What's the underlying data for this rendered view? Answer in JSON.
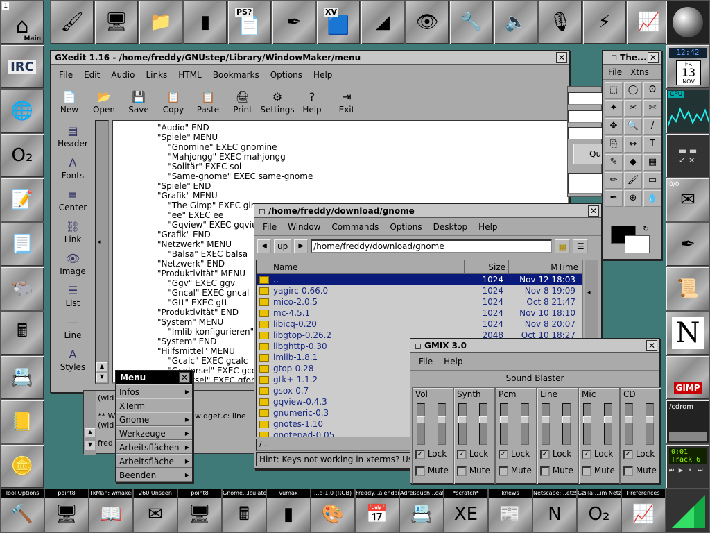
{
  "dock_top": [
    {
      "name": "main",
      "label": "Main",
      "glyph": "⌂",
      "badge": "1"
    },
    {
      "name": "paint",
      "glyph": "🖌"
    },
    {
      "name": "computer",
      "glyph": "🖥"
    },
    {
      "name": "folder",
      "glyph": "📁"
    },
    {
      "name": "drive",
      "glyph": "▮"
    },
    {
      "name": "ps-viewer",
      "label": "PS?",
      "glyph": "📄"
    },
    {
      "name": "acrobat",
      "glyph": "✒"
    },
    {
      "name": "xv",
      "label": "XV",
      "glyph": "🟦"
    },
    {
      "name": "xfig",
      "glyph": "◢"
    },
    {
      "name": "eye",
      "glyph": "👁"
    },
    {
      "name": "tools",
      "glyph": "🔧"
    },
    {
      "name": "speaker",
      "glyph": "🔈"
    },
    {
      "name": "microphone",
      "glyph": "🎙"
    },
    {
      "name": "network",
      "glyph": "⚡"
    },
    {
      "name": "monitor-graph",
      "glyph": "📈"
    }
  ],
  "dock_left": [
    {
      "name": "irc",
      "label": "IRC"
    },
    {
      "name": "earth-tools",
      "glyph": "🌐"
    },
    {
      "name": "o2",
      "glyph": "O₂"
    },
    {
      "name": "notepad",
      "glyph": "📝"
    },
    {
      "name": "document",
      "glyph": "📃"
    },
    {
      "name": "gnu",
      "glyph": "🐃"
    },
    {
      "name": "calculator",
      "glyph": "🖩"
    },
    {
      "name": "rolodex",
      "glyph": "📇"
    },
    {
      "name": "address",
      "glyph": "📒"
    },
    {
      "name": "coins",
      "glyph": "🪙"
    }
  ],
  "dock_right": {
    "clock_time": "12:42",
    "date_day": "FR",
    "date_num": "13",
    "date_month": "NOV",
    "cpu_label": "CPU",
    "mail_count": "0/0",
    "netscape": "N",
    "gimp": "GIMP",
    "cdrom_label": "/cdrom",
    "track_time": "0:01",
    "track_label": "Track",
    "track_num": "6"
  },
  "gxedit": {
    "title": "GXedit 1.16 - /home/freddy/GNUstep/Library/WindowMaker/menu",
    "menus": [
      "File",
      "Edit",
      "Audio",
      "Links",
      "HTML",
      "Bookmarks",
      "Options",
      "Help"
    ],
    "toolbar": [
      {
        "name": "new",
        "label": "New",
        "glyph": "📄"
      },
      {
        "name": "open",
        "label": "Open",
        "glyph": "📂"
      },
      {
        "name": "save",
        "label": "Save",
        "glyph": "💾"
      },
      {
        "name": "copy",
        "label": "Copy",
        "glyph": "📋"
      },
      {
        "name": "paste",
        "label": "Paste",
        "glyph": "📋"
      },
      {
        "name": "print",
        "label": "Print",
        "glyph": "🖨"
      },
      {
        "name": "settings",
        "label": "Settings",
        "glyph": "⚙"
      },
      {
        "name": "help",
        "label": "Help",
        "glyph": "?"
      },
      {
        "name": "exit",
        "label": "Exit",
        "glyph": "⇥"
      }
    ],
    "sidebar": [
      {
        "name": "header",
        "label": "Header",
        "glyph": "▤"
      },
      {
        "name": "fonts",
        "label": "Fonts",
        "glyph": "A"
      },
      {
        "name": "center",
        "label": "Center",
        "glyph": "≡"
      },
      {
        "name": "link",
        "label": "Link",
        "glyph": "⛓"
      },
      {
        "name": "image",
        "label": "Image",
        "glyph": "👁"
      },
      {
        "name": "list",
        "label": "List",
        "glyph": "☰"
      },
      {
        "name": "line",
        "label": "Line",
        "glyph": "—"
      },
      {
        "name": "styles",
        "label": "Styles",
        "glyph": "A"
      }
    ],
    "lines": [
      "\"Audio\" END",
      "\"Spiele\" MENU",
      "    \"Gnomine\" EXEC gnomine",
      "    \"Mahjongg\" EXEC mahjongg",
      "    \"Solitär\" EXEC sol",
      "    \"Same-gnome\" EXEC same-gnome",
      "\"Spiele\" END",
      "\"Grafik\" MENU",
      "    \"The Gimp\" EXEC gimp",
      "    \"ee\" EXEC ee",
      "    \"Gqview\" EXEC gqview",
      "\"Grafik\" END",
      "\"Netzwerk\" MENU",
      "    \"Balsa\" EXEC balsa",
      "\"Netzwerk\" END",
      "\"Produktivität\" MENU",
      "    \"Ggv\" EXEC ggv",
      "    \"Gncal\" EXEC gncal",
      "    \"Gtt\" EXEC gtt",
      "\"Produktivität\" END",
      "\"System\" MENU",
      "    \"Imlib konfigurieren\"",
      "\"System\" END",
      "\"Hilfsmittel\" MENU",
      "    \"Gcalc\" EXEC gcalc",
      "    \"Gcolorsel\" EXEC gcolorsel",
      "    \"Gfontsel\" EXEC gfontsel"
    ],
    "console": [
      "(wid",
      "",
      "** W",
      "(wid",
      "",
      "fred"
    ],
    "console_extra": "widget.c: line"
  },
  "thegimp": {
    "title": "The...",
    "menus": [
      "File",
      "Xtns"
    ],
    "tools": [
      "⬚",
      "◯",
      "ʘ",
      "✦",
      "✂",
      "✄",
      "✥",
      "🔍",
      "/",
      "⎘",
      "↔",
      "T",
      "✎",
      "◆",
      "▦",
      "✏",
      "🖌",
      "▭",
      "✒",
      "⊕",
      "💧"
    ]
  },
  "filemanager": {
    "title": "/home/freddy/download/gnome",
    "menus": [
      "File",
      "Window",
      "Commands",
      "Options",
      "Desktop",
      "Help"
    ],
    "up_label": "up",
    "path": "/home/freddy/download/gnome",
    "columns": [
      "Name",
      "Size",
      "MTime"
    ],
    "rows": [
      {
        "name": "..",
        "size": "1024",
        "mtime": "Nov 12 18:03"
      },
      {
        "name": "yagirc-0.66.0",
        "size": "1024",
        "mtime": "Nov  8 19:09"
      },
      {
        "name": "mico-2.0.5",
        "size": "1024",
        "mtime": "Oct  8 21:47"
      },
      {
        "name": "mc-4.5.1",
        "size": "1024",
        "mtime": "Nov 10 18:10"
      },
      {
        "name": "libicq-0.20",
        "size": "1024",
        "mtime": "Nov  8 20:07"
      },
      {
        "name": "libgtop-0.26.2",
        "size": "2048",
        "mtime": "Oct 10 18:27"
      },
      {
        "name": "libghttp-0.30",
        "size": "",
        "mtime": ""
      },
      {
        "name": "imlib-1.8.1",
        "size": "",
        "mtime": ""
      },
      {
        "name": "gtop-0.28",
        "size": "",
        "mtime": ""
      },
      {
        "name": "gtk+-1.1.2",
        "size": "",
        "mtime": ""
      },
      {
        "name": "gsox-0.7",
        "size": "",
        "mtime": ""
      },
      {
        "name": "gqview-0.4.3",
        "size": "",
        "mtime": ""
      },
      {
        "name": "gnumeric-0.3",
        "size": "",
        "mtime": ""
      },
      {
        "name": "gnotes-1.10",
        "size": "",
        "mtime": ""
      },
      {
        "name": "gnotepad-0.05",
        "size": "",
        "mtime": ""
      }
    ],
    "cmdline": "/ ..",
    "hint": "Hint: Keys not working in xterms? Use"
  },
  "rootmenu": {
    "title": "Menu",
    "items": [
      {
        "label": "Infos",
        "sub": true
      },
      {
        "label": "XTerm",
        "sub": false
      },
      {
        "label": "Gnome",
        "sub": true
      },
      {
        "label": "Werkzeuge",
        "sub": true
      },
      {
        "label": "Arbeitsflächen",
        "sub": true
      },
      {
        "label": "Arbeitsfläche",
        "sub": true
      },
      {
        "label": "Beenden",
        "sub": true
      }
    ]
  },
  "gmix": {
    "title": "GMIX 3.0",
    "menus": [
      "File",
      "Help"
    ],
    "card": "Sound Blaster",
    "lock_label": "Lock",
    "mute_label": "Mute",
    "channels": [
      {
        "name": "Vol",
        "lock": true,
        "mute": false
      },
      {
        "name": "Synth",
        "lock": true,
        "mute": false
      },
      {
        "name": "Pcm",
        "lock": true,
        "mute": false
      },
      {
        "name": "Line",
        "lock": true,
        "mute": false
      },
      {
        "name": "Mic",
        "lock": true,
        "mute": false
      },
      {
        "name": "CD",
        "lock": true,
        "mute": false
      }
    ]
  },
  "taskbar": [
    {
      "label": "Tool Options",
      "glyph": "🔨"
    },
    {
      "label": "point8",
      "glyph": "🖥"
    },
    {
      "label": "TkMan: wmaker",
      "glyph": "📖"
    },
    {
      "label": "260 Unseen",
      "glyph": "✉"
    },
    {
      "label": "point8",
      "glyph": "🖥"
    },
    {
      "label": "Gnome...lculator",
      "glyph": "🖩"
    },
    {
      "label": "vumax",
      "glyph": "▮"
    },
    {
      "label": "...d-1.0 (RGB)",
      "glyph": "🎨"
    },
    {
      "label": "Freddy...alendar",
      "glyph": "📅"
    },
    {
      "label": "Adreßbuch...daf",
      "glyph": "📇"
    },
    {
      "label": "*scratch*",
      "glyph": "XE"
    },
    {
      "label": "knews",
      "glyph": "📰"
    },
    {
      "label": "Netscape:...etz!",
      "glyph": "N"
    },
    {
      "label": "Gzilla:...im Netz!",
      "glyph": "O₂"
    },
    {
      "label": "Preferences",
      "glyph": "📈"
    }
  ]
}
